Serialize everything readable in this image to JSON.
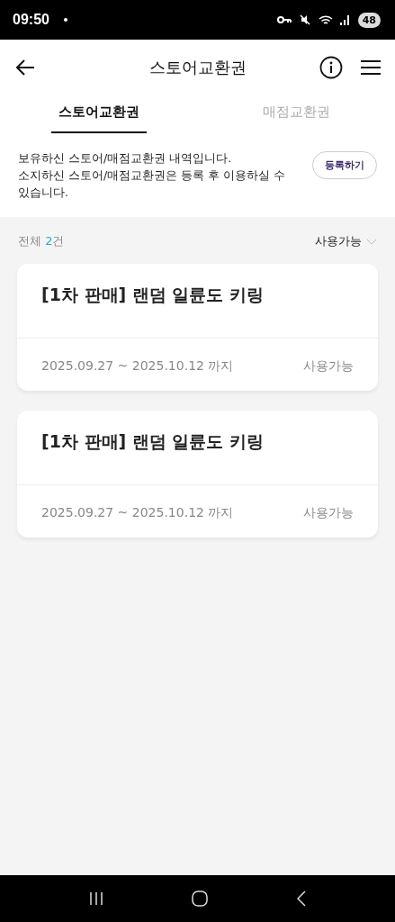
{
  "status_bar": {
    "time": "09:50",
    "battery": "48"
  },
  "header": {
    "title": "스토어교환권"
  },
  "tabs": [
    {
      "label": "스토어교환권",
      "selected": true
    },
    {
      "label": "매점교환권",
      "selected": false
    }
  ],
  "notice": {
    "lines": [
      "보유하신 스토어/매점교환권 내역입니다.",
      "소지하신 스토어/매점교환권은 등록 후 이용하실 수 있습니다."
    ],
    "button": "등록하기"
  },
  "summary": {
    "label": "전체",
    "count": "2",
    "unit": "건",
    "filter": "사용가능"
  },
  "vouchers": [
    {
      "title": "[1차 판매] 랜덤 일륜도 키링",
      "period": "2025.09.27 ~ 2025.10.12 까지",
      "status": "사용가능"
    },
    {
      "title": "[1차 판매] 랜덤 일륜도 키링",
      "period": "2025.09.27 ~ 2025.10.12 까지",
      "status": "사용가능"
    }
  ]
}
